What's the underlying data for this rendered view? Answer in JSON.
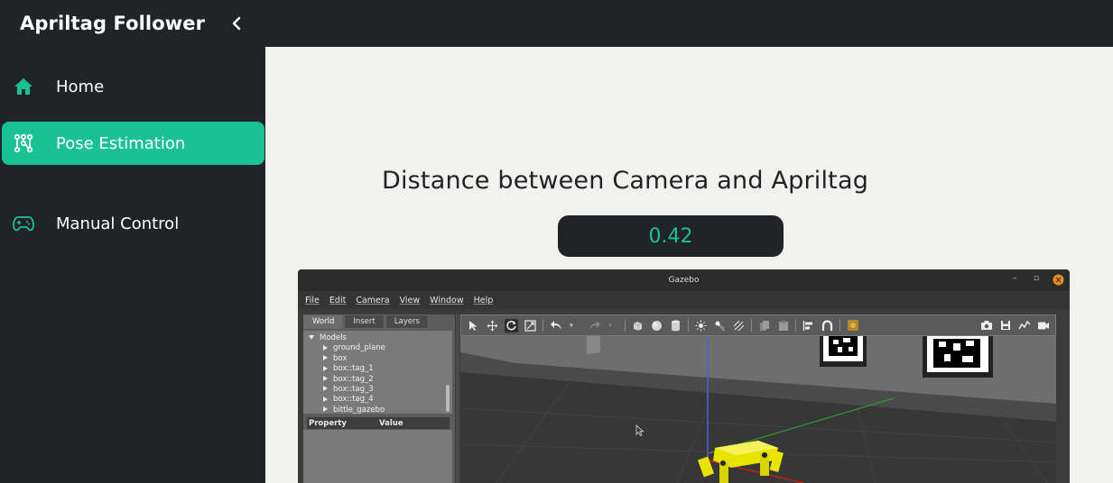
{
  "app": {
    "title": "Apriltag Follower"
  },
  "sidebar": {
    "items": [
      {
        "label": "Home",
        "icon": "home-icon",
        "active": false
      },
      {
        "label": "Pose Estimation",
        "icon": "graph-icon",
        "active": true
      },
      {
        "label": "Manual Control",
        "icon": "gamepad-icon",
        "active": false
      }
    ]
  },
  "main": {
    "heading": "Distance between Camera and Apriltag",
    "distance_value": "0.42"
  },
  "gazebo": {
    "title": "Gazebo",
    "menus": [
      "File",
      "Edit",
      "Camera",
      "View",
      "Window",
      "Help"
    ],
    "tabs": [
      "World",
      "Insert",
      "Layers"
    ],
    "tree_root": "Models",
    "models": [
      "ground_plane",
      "box",
      "box::tag_1",
      "box::tag_2",
      "box::tag_3",
      "box::tag_4",
      "bittle_gazebo"
    ],
    "property_header": {
      "property": "Property",
      "value": "Value"
    }
  },
  "colors": {
    "accent": "#1ac195",
    "sidebar_bg": "#202427",
    "main_bg": "#f1f2f0",
    "robot": "#e8e400"
  }
}
